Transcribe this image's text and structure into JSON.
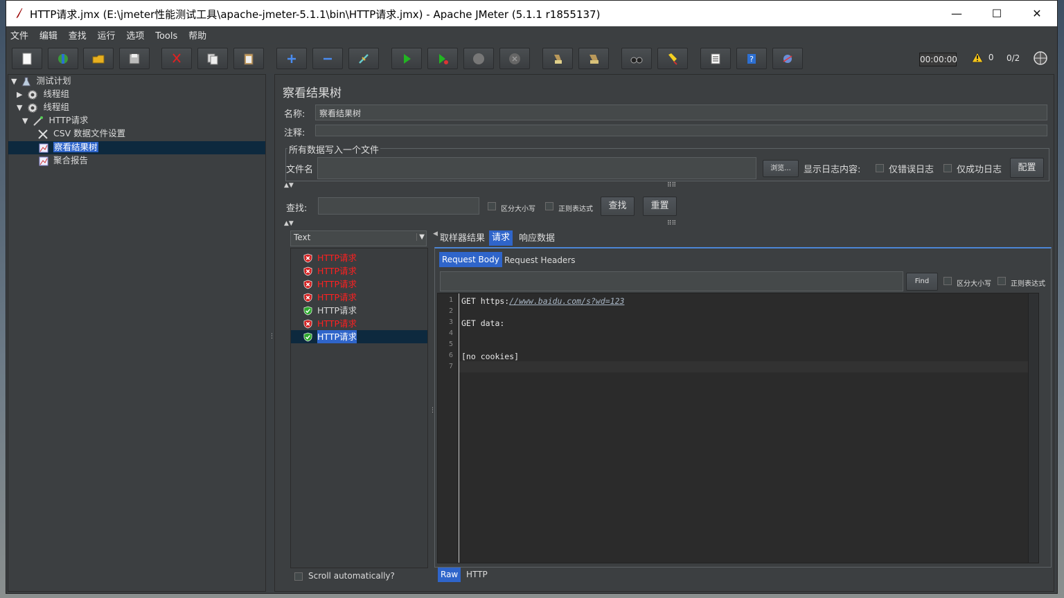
{
  "window": {
    "title": "HTTP请求.jmx (E:\\jmeter性能测试工具\\apache-jmeter-5.1.1\\bin\\HTTP请求.jmx) - Apache JMeter (5.1.1 r1855137)",
    "minimize": "—",
    "maximize": "☐",
    "close": "✕"
  },
  "menu": [
    "文件",
    "编辑",
    "查找",
    "运行",
    "选项",
    "Tools",
    "帮助"
  ],
  "toolbar": {
    "timer": "00:00:00",
    "warnings": "0",
    "threads": "0/2"
  },
  "tree": {
    "items": [
      {
        "label": "测试计划"
      },
      {
        "label": "线程组"
      },
      {
        "label": "线程组"
      },
      {
        "label": "HTTP请求"
      },
      {
        "label": "CSV 数据文件设置"
      },
      {
        "label": "察看结果树"
      },
      {
        "label": "聚合报告"
      }
    ]
  },
  "panel": {
    "title": "察看结果树",
    "name_label": "名称:",
    "name_value": "察看结果树",
    "comment_label": "注释:",
    "comment_value": "",
    "file_group_title": "所有数据写入一个文件",
    "filename_label": "文件名",
    "filename_value": "",
    "browse_label": "浏览...",
    "log_label": "显示日志内容:",
    "errors_only_label": "仅错误日志",
    "success_only_label": "仅成功日志",
    "configure_label": "配置",
    "search_label": "查找:",
    "search_value": "",
    "case_sensitive_label": "区分大小写",
    "regex_label": "正则表达式",
    "find_button": "查找",
    "reset_button": "重置"
  },
  "results": {
    "renderer": "Text",
    "samples": [
      {
        "label": "HTTP请求",
        "status": "fail"
      },
      {
        "label": "HTTP请求",
        "status": "fail"
      },
      {
        "label": "HTTP请求",
        "status": "fail"
      },
      {
        "label": "HTTP请求",
        "status": "fail"
      },
      {
        "label": "HTTP请求",
        "status": "success"
      },
      {
        "label": "HTTP请求",
        "status": "fail"
      },
      {
        "label": "HTTP请求",
        "status": "success",
        "selected": true
      }
    ],
    "scroll_auto_label": "Scroll automatically?"
  },
  "detail": {
    "tabs": [
      "取样器结果",
      "请求",
      "响应数据"
    ],
    "subtabs": [
      "Request Body",
      "Request Headers"
    ],
    "find_label": "Find",
    "case_label": "区分大小写",
    "regex_label": "正则表达式",
    "lines": [
      {
        "n": "1",
        "prefix": "GET https:",
        "link": "//www.baidu.com/s?wd=123"
      },
      {
        "n": "2",
        "prefix": "",
        "link": ""
      },
      {
        "n": "3",
        "prefix": "GET data:",
        "link": ""
      },
      {
        "n": "4",
        "prefix": "",
        "link": ""
      },
      {
        "n": "5",
        "prefix": "",
        "link": ""
      },
      {
        "n": "6",
        "prefix": "[no cookies]",
        "link": ""
      },
      {
        "n": "7",
        "prefix": "",
        "link": ""
      }
    ],
    "bottom_tabs": [
      "Raw",
      "HTTP"
    ]
  },
  "colors": {
    "fail": "#ff2020",
    "selection": "#2f65ca",
    "background": "#3c3f41"
  }
}
